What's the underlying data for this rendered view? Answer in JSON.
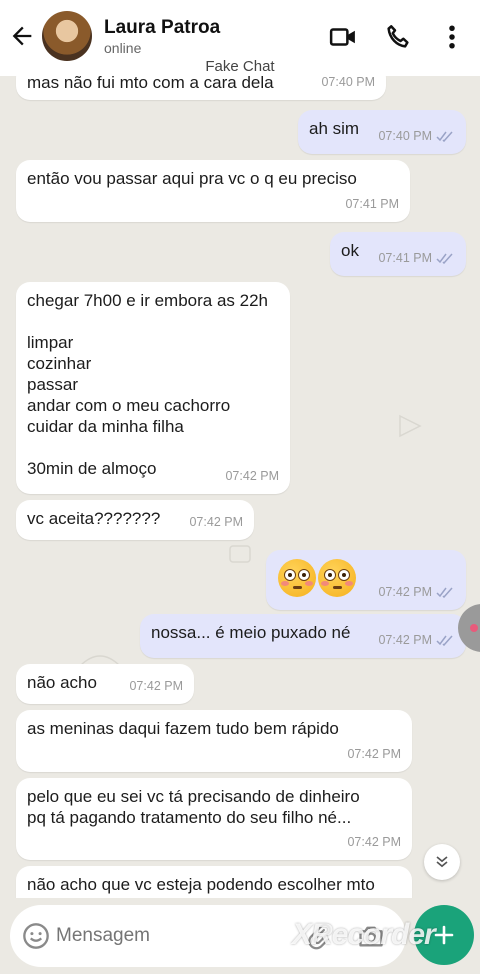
{
  "header": {
    "contact_name": "Laura Patroa",
    "status": "online",
    "banner": "Fake Chat",
    "icons": [
      "back-arrow-icon",
      "video-call-icon",
      "phone-call-icon",
      "more-options-icon"
    ]
  },
  "messages": [
    {
      "dir": "in",
      "text": "mas não fui mto com a cara dela",
      "time": "07:40 PM"
    },
    {
      "dir": "out",
      "text": "ah sim",
      "time": "07:40 PM"
    },
    {
      "dir": "in",
      "text": "então vou passar aqui pra vc o q eu preciso",
      "time": "07:41 PM"
    },
    {
      "dir": "out",
      "text": "ok",
      "time": "07:41 PM"
    },
    {
      "dir": "in",
      "text": "chegar 7h00 e ir embora as 22h\n\nlimpar\ncozinhar\npassar\nandar com o meu cachorro\ncuidar da minha filha\n\n30min de almoço",
      "time": "07:42 PM"
    },
    {
      "dir": "in",
      "text": "vc aceita???????",
      "time": "07:42 PM"
    },
    {
      "dir": "out",
      "text": "😳😳",
      "time": "07:42 PM"
    },
    {
      "dir": "out",
      "text": "nossa... é meio puxado né",
      "time": "07:42 PM"
    },
    {
      "dir": "in",
      "text": "não acho",
      "time": "07:42 PM"
    },
    {
      "dir": "in",
      "text": "as meninas daqui fazem tudo bem rápido",
      "time": "07:42 PM"
    },
    {
      "dir": "in",
      "text": "pelo que eu sei vc tá precisando de dinheiro\npq tá pagando tratamento do seu filho né...",
      "time": "07:42 PM"
    },
    {
      "dir": "in",
      "text": "não acho que vc esteja podendo escolher mto",
      "time": ""
    }
  ],
  "input": {
    "placeholder": "Mensagem",
    "watermark": "XRecorder"
  },
  "colors": {
    "incoming_bubble": "#ffffff",
    "outgoing_bubble": "#e3e5fb",
    "send_button": "#1aa37a",
    "chat_background": "#ebe9e3"
  }
}
